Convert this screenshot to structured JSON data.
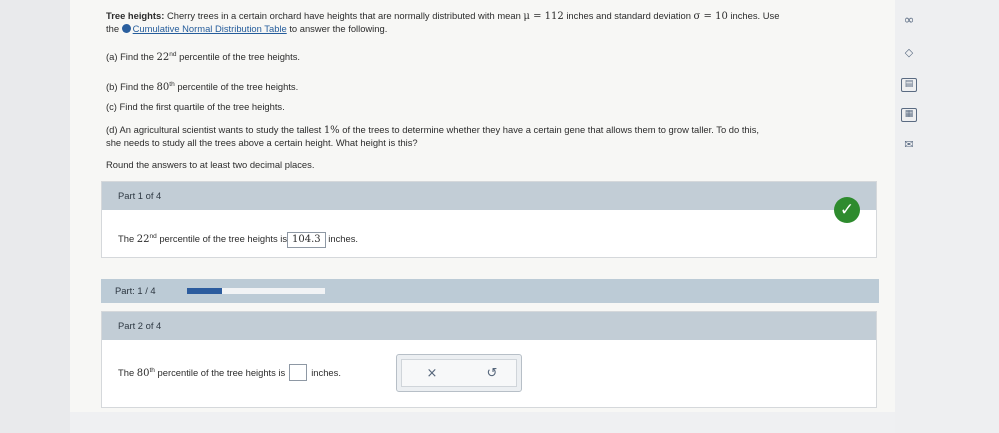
{
  "problem": {
    "title": "Tree heights:",
    "intro_a": "Cherry trees in a certain orchard have heights that are normally distributed with mean",
    "mu": "μ = 112",
    "intro_b": "inches and standard deviation",
    "sigma": "σ = 10",
    "intro_c": "inches. Use",
    "the": "the",
    "link_text": "Cumulative Normal Distribution Table",
    "intro_d": "to answer the following."
  },
  "questions": {
    "a_pre": "(a) Find the",
    "a_num": "22",
    "a_sup": "nd",
    "a_post": "percentile of the tree heights.",
    "b_pre": "(b) Find the",
    "b_num": "80",
    "b_sup": "th",
    "b_post": "percentile of the tree heights.",
    "c": "(c) Find the first quartile of the tree heights.",
    "d_pre": "(d) An agricultural scientist wants to study the tallest",
    "d_pct": "1%",
    "d_post": "of the trees to determine whether they have a certain gene that allows them to grow taller. To do this,",
    "d_line2": "she needs to study all the trees above a certain height. What height is this?",
    "round": "Round the answers to at least two decimal places."
  },
  "part1": {
    "header": "Part 1 of 4",
    "pre": "The",
    "num": "22",
    "sup": "nd",
    "mid": "percentile of the tree heights is",
    "answer": "104.3",
    "unit": "inches."
  },
  "progress": {
    "label": "Part: 1 / 4",
    "fraction": 0.25
  },
  "part2": {
    "header": "Part 2 of 4",
    "pre": "The",
    "num": "80",
    "sup": "th",
    "mid": "percentile of the tree heights is",
    "answer": "",
    "unit": "inches."
  },
  "tools": {
    "clear_icon": "×",
    "undo_icon": "↺"
  },
  "sidebar_icons": {
    "infinity": "∞",
    "diamond": "◇",
    "calculator": "▤",
    "table": "▦",
    "mail": "✉"
  },
  "colors": {
    "header_bar": "#c2cdd6",
    "progress_fill": "#2c5c9e",
    "check_green": "#2e8b2e",
    "link": "#245c9b"
  }
}
